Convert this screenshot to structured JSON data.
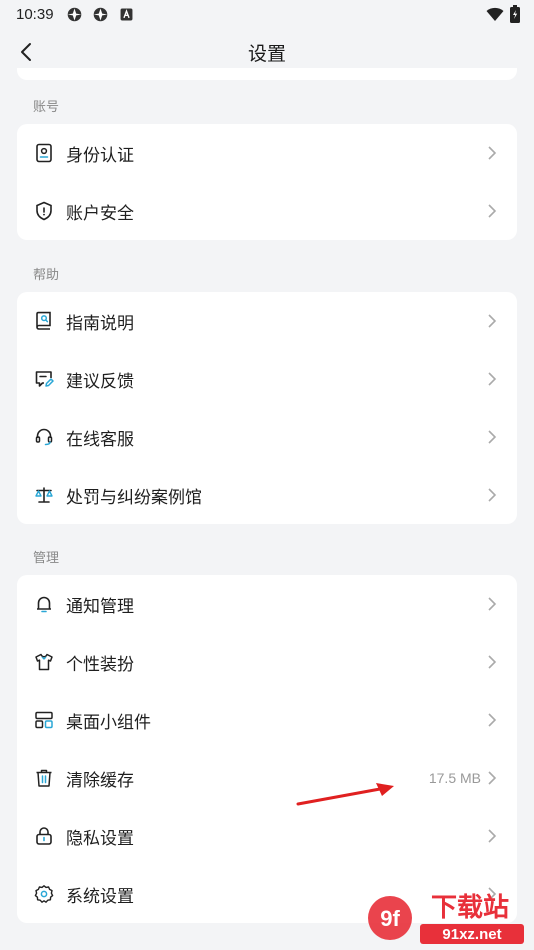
{
  "status_bar": {
    "time": "10:39"
  },
  "header": {
    "title": "设置"
  },
  "sections": [
    {
      "title": "账号",
      "items": [
        {
          "label": "身份认证",
          "icon": "id-card-icon"
        },
        {
          "label": "账户安全",
          "icon": "shield-icon"
        }
      ]
    },
    {
      "title": "帮助",
      "items": [
        {
          "label": "指南说明",
          "icon": "guide-book-icon"
        },
        {
          "label": "建议反馈",
          "icon": "feedback-edit-icon"
        },
        {
          "label": "在线客服",
          "icon": "headset-icon"
        },
        {
          "label": "处罚与纠纷案例馆",
          "icon": "scale-icon"
        }
      ]
    },
    {
      "title": "管理",
      "items": [
        {
          "label": "通知管理",
          "icon": "bell-icon"
        },
        {
          "label": "个性装扮",
          "icon": "shirt-icon"
        },
        {
          "label": "桌面小组件",
          "icon": "widgets-icon"
        },
        {
          "label": "清除缓存",
          "icon": "trash-icon",
          "value": "17.5 MB"
        },
        {
          "label": "隐私设置",
          "icon": "lock-icon"
        },
        {
          "label": "系统设置",
          "icon": "gear-icon"
        }
      ]
    }
  ],
  "watermark": {
    "text_main": "下载站",
    "text_domain": "91xz.net",
    "logo_text": "9f"
  },
  "colors": {
    "accent": "#2aa7d6",
    "background": "#f3f4f6",
    "card": "#ffffff",
    "annotation": "#e02020",
    "watermark_red": "#e8303a"
  }
}
